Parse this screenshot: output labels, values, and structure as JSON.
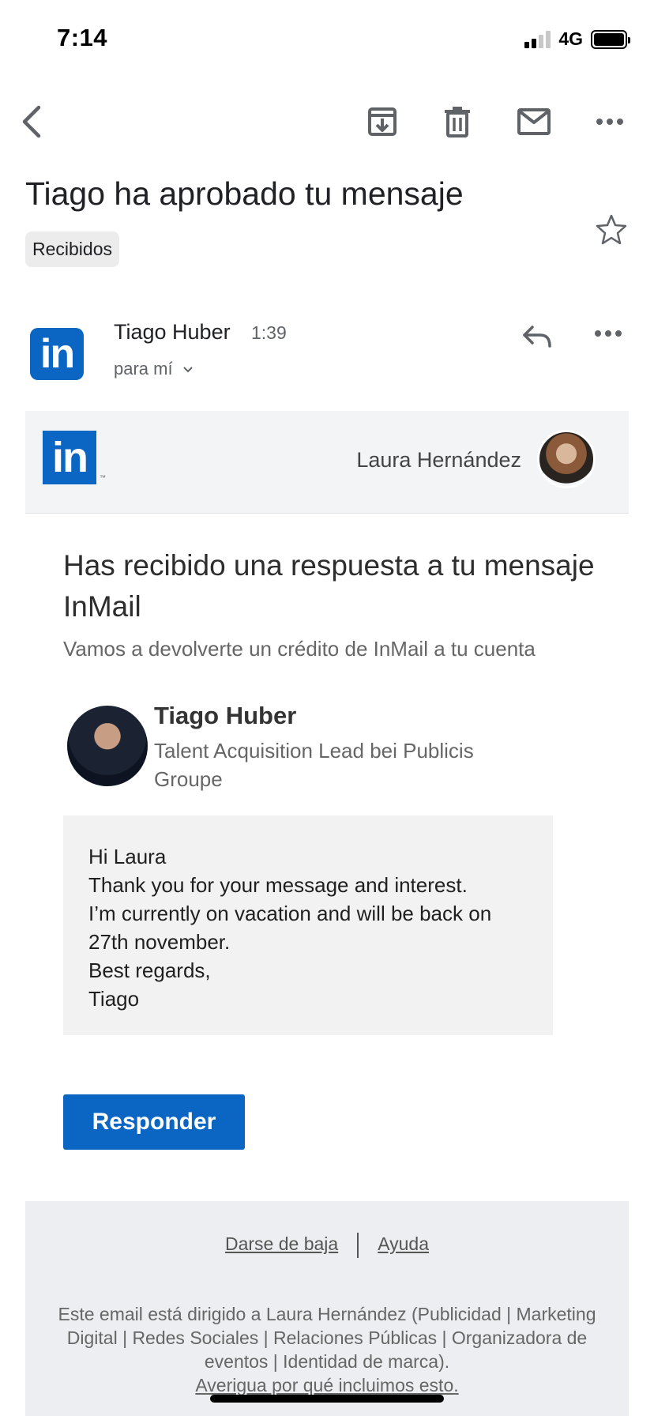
{
  "status_bar": {
    "time": "7:14",
    "network": "4G"
  },
  "toolbar": {
    "icons": [
      "back-icon",
      "archive-icon",
      "trash-icon",
      "mail-icon",
      "more-icon"
    ]
  },
  "email": {
    "subject": "Tiago ha aprobado tu mensaje",
    "label": "Recibidos",
    "sender": {
      "name": "Tiago Huber",
      "time": "1:39",
      "to": "para mí"
    }
  },
  "content": {
    "recipient_name": "Laura Hernández",
    "headline": "Has recibido una respuesta a tu mensaje InMail",
    "subheadline": "Vamos a devolverte un crédito de InMail a tu cuenta",
    "person": {
      "name": "Tiago Huber",
      "title": "Talent Acquisition Lead bei Publicis Groupe"
    },
    "message_lines": [
      "Hi Laura",
      "Thank you for your message and interest.",
      "I’m currently on vacation and will be back on 27th november.",
      "Best regards,",
      "Tiago"
    ],
    "cta_label": "Responder"
  },
  "footer": {
    "unsubscribe": "Darse de baja",
    "help": "Ayuda",
    "disclaimer": "Este email está dirigido a Laura Hernández (Publicidad | Marketing Digital | Redes Sociales | Relaciones Públicas | Organizadora de eventos | Identidad de marca).",
    "why_link": "Averigua por qué incluimos esto."
  },
  "logo_text": "in",
  "colors": {
    "linkedin_blue": "#0a66c2",
    "header_bg": "#f3f4f6",
    "footer_bg": "#eceef1"
  }
}
